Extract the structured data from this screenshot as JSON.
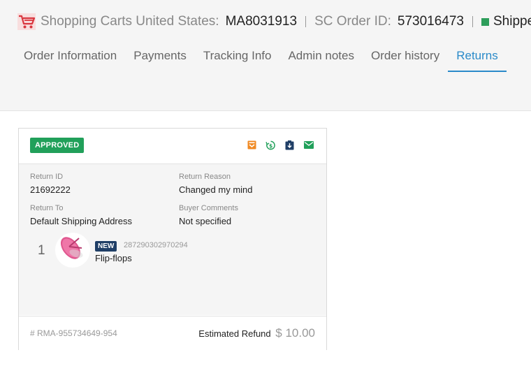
{
  "header": {
    "store": "Shopping Carts United States:",
    "store_id": "MA8031913",
    "order_label": "SC Order ID:",
    "order_id": "573016473",
    "status": "Shipped",
    "status_color": "#2e9e5b",
    "cart_icon_color": "#d9363e"
  },
  "tabs": [
    {
      "label": "Order Information"
    },
    {
      "label": "Payments"
    },
    {
      "label": "Tracking Info"
    },
    {
      "label": "Admin notes"
    },
    {
      "label": "Order history"
    },
    {
      "label": "Returns",
      "active": true
    }
  ],
  "return_card": {
    "status_badge": "APPROVED",
    "actions": [
      "box-icon",
      "refund-icon",
      "label-icon",
      "email-icon"
    ],
    "return_id_label": "Return ID",
    "return_id": "21692222",
    "reason_label": "Return Reason",
    "reason": "Changed my mind",
    "return_to_label": "Return To",
    "return_to": "Default Shipping Address",
    "comments_label": "Buyer Comments",
    "comments": "Not specified",
    "item": {
      "quantity": "1",
      "condition": "NEW",
      "sku": "287290302970294",
      "name": "Flip-flops"
    },
    "rma": "# RMA-955734649-954",
    "refund_label": "Estimated Refund",
    "refund_amount": "$ 10.00"
  }
}
